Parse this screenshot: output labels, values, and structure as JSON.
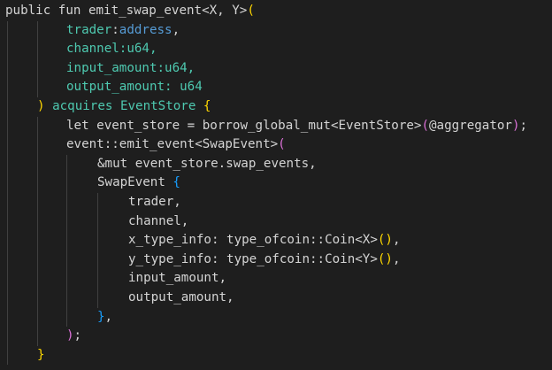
{
  "editor": {
    "background": "#1e1e1e",
    "lines": [
      {
        "indent": 0,
        "tokens": [
          {
            "t": "public fun emit_swap_event<X, Y>",
            "c": "plain"
          },
          {
            "t": "(",
            "c": "gold"
          }
        ]
      },
      {
        "indent": 2,
        "tokens": [
          {
            "t": "trader",
            "c": "teal"
          },
          {
            "t": ":",
            "c": "plain"
          },
          {
            "t": "address",
            "c": "blue"
          },
          {
            "t": ",",
            "c": "plain"
          }
        ]
      },
      {
        "indent": 2,
        "tokens": [
          {
            "t": "channel",
            "c": "teal"
          },
          {
            "t": ":u64,",
            "c": "teal"
          }
        ]
      },
      {
        "indent": 2,
        "tokens": [
          {
            "t": "input_amount",
            "c": "teal"
          },
          {
            "t": ":u64,",
            "c": "teal"
          }
        ]
      },
      {
        "indent": 2,
        "tokens": [
          {
            "t": "output_amount",
            "c": "teal"
          },
          {
            "t": ": u64",
            "c": "teal"
          }
        ]
      },
      {
        "indent": 1,
        "tokens": [
          {
            "t": ")",
            "c": "gold"
          },
          {
            "t": " acquires EventStore ",
            "c": "teal"
          },
          {
            "t": "{",
            "c": "gold"
          }
        ]
      },
      {
        "indent": 2,
        "tokens": [
          {
            "t": "let event_store = borrow_global_mut<EventStore>",
            "c": "plain"
          },
          {
            "t": "(",
            "c": "purple"
          },
          {
            "t": "@aggregator",
            "c": "plain"
          },
          {
            "t": ")",
            "c": "purple"
          },
          {
            "t": ";",
            "c": "plain"
          }
        ]
      },
      {
        "indent": 2,
        "tokens": [
          {
            "t": "event::emit_event<SwapEvent>",
            "c": "plain"
          },
          {
            "t": "(",
            "c": "purple"
          }
        ]
      },
      {
        "indent": 3,
        "tokens": [
          {
            "t": "&mut event_store.swap_events,",
            "c": "plain"
          }
        ]
      },
      {
        "indent": 3,
        "tokens": [
          {
            "t": "SwapEvent ",
            "c": "plain"
          },
          {
            "t": "{",
            "c": "bracket3"
          }
        ]
      },
      {
        "indent": 4,
        "tokens": [
          {
            "t": "trader,",
            "c": "plain"
          }
        ]
      },
      {
        "indent": 4,
        "tokens": [
          {
            "t": "channel,",
            "c": "plain"
          }
        ]
      },
      {
        "indent": 4,
        "tokens": [
          {
            "t": "x_type_info: type_ofcoin::Coin<X>",
            "c": "plain"
          },
          {
            "t": "()",
            "c": "gold"
          },
          {
            "t": ",",
            "c": "plain"
          }
        ]
      },
      {
        "indent": 4,
        "tokens": [
          {
            "t": "y_type_info: type_ofcoin::Coin<Y>",
            "c": "plain"
          },
          {
            "t": "()",
            "c": "gold"
          },
          {
            "t": ",",
            "c": "plain"
          }
        ]
      },
      {
        "indent": 4,
        "tokens": [
          {
            "t": "input_amount,",
            "c": "plain"
          }
        ]
      },
      {
        "indent": 4,
        "tokens": [
          {
            "t": "output_amount,",
            "c": "plain"
          }
        ]
      },
      {
        "indent": 3,
        "tokens": [
          {
            "t": "}",
            "c": "bracket3"
          },
          {
            "t": ",",
            "c": "plain"
          }
        ]
      },
      {
        "indent": 2,
        "tokens": [
          {
            "t": ")",
            "c": "purple"
          },
          {
            "t": ";",
            "c": "plain"
          }
        ]
      },
      {
        "indent": 1,
        "tokens": [
          {
            "t": "}",
            "c": "gold"
          }
        ]
      }
    ]
  }
}
